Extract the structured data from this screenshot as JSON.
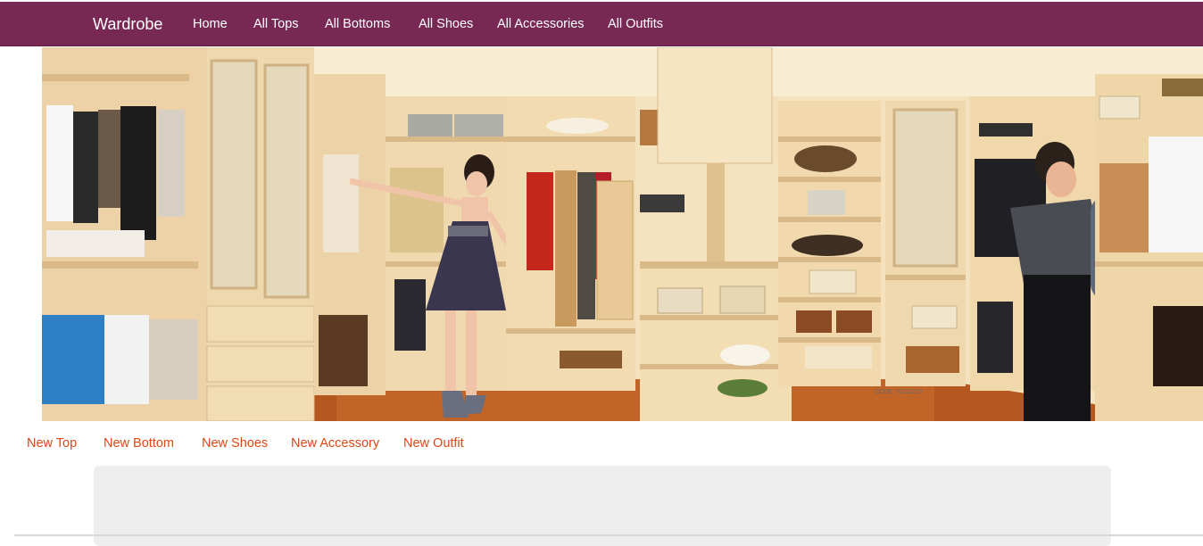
{
  "navbar": {
    "brand": "Wardrobe",
    "background_color": "#772953",
    "links": [
      {
        "label": "Home"
      },
      {
        "label": "All Tops"
      },
      {
        "label": "All Bottoms"
      },
      {
        "label": "All Shoes"
      },
      {
        "label": "All Accessories"
      },
      {
        "label": "All Outfits"
      }
    ]
  },
  "hero": {
    "code_label": "CODE: YG11213"
  },
  "subnav": {
    "link_color": "#dd4814",
    "links": [
      {
        "label": "New Top"
      },
      {
        "label": "New Bottom"
      },
      {
        "label": "New Shoes"
      },
      {
        "label": "New Accessory"
      },
      {
        "label": "New Outfit"
      }
    ]
  }
}
